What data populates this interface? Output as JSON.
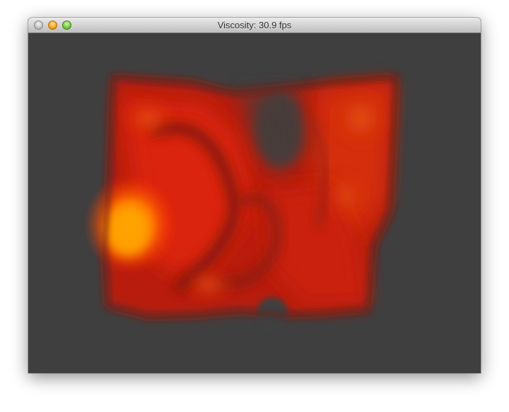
{
  "window": {
    "title": "Viscosity: 30.9 fps"
  },
  "colors": {
    "canvas_background": "#3f3f3f",
    "fluid_hot": "#ff9a00",
    "fluid_mid": "#e8200a",
    "fluid_dark": "#8a1a10"
  }
}
